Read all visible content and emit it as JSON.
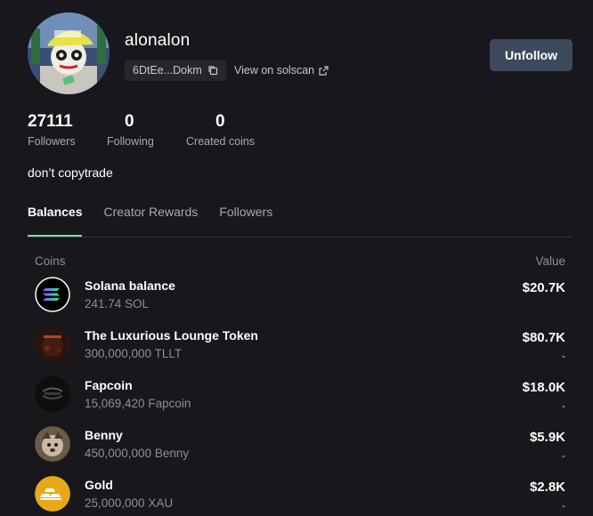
{
  "profile": {
    "username": "alonalon",
    "address_short": "6DtEe...Dokm",
    "solscan_label": "View on solscan",
    "unfollow_label": "Unfollow",
    "bio": "don’t copytrade"
  },
  "stats": {
    "followers": {
      "value": "27111",
      "label": "Followers"
    },
    "following": {
      "value": "0",
      "label": "Following"
    },
    "created": {
      "value": "0",
      "label": "Created coins"
    }
  },
  "tabs": [
    {
      "label": "Balances",
      "active": true
    },
    {
      "label": "Creator Rewards",
      "active": false
    },
    {
      "label": "Followers",
      "active": false
    }
  ],
  "table": {
    "col_coins": "Coins",
    "col_value": "Value",
    "rows": [
      {
        "name": "Solana balance",
        "balance": "241.74 SOL",
        "value": "$20.7K",
        "sub": "",
        "icon": "solana-icon"
      },
      {
        "name": "The Luxurious Lounge Token",
        "balance": "300,000,000 TLLT",
        "value": "$80.7K",
        "sub": "-",
        "icon": "lounge-token-icon"
      },
      {
        "name": "Fapcoin",
        "balance": "15,069,420 Fapcoin",
        "value": "$18.0K",
        "sub": "-",
        "icon": "fapcoin-icon"
      },
      {
        "name": "Benny",
        "balance": "450,000,000 Benny",
        "value": "$5.9K",
        "sub": "-",
        "icon": "benny-icon"
      },
      {
        "name": "Gold",
        "balance": "25,000,000 XAU",
        "value": "$2.8K",
        "sub": "-",
        "icon": "gold-icon"
      }
    ]
  },
  "colors": {
    "background": "#17171c",
    "accent_tab_underline": "#7ce0a8",
    "unfollow_button": "#3d4a5c",
    "muted_text": "#8e8e96"
  }
}
